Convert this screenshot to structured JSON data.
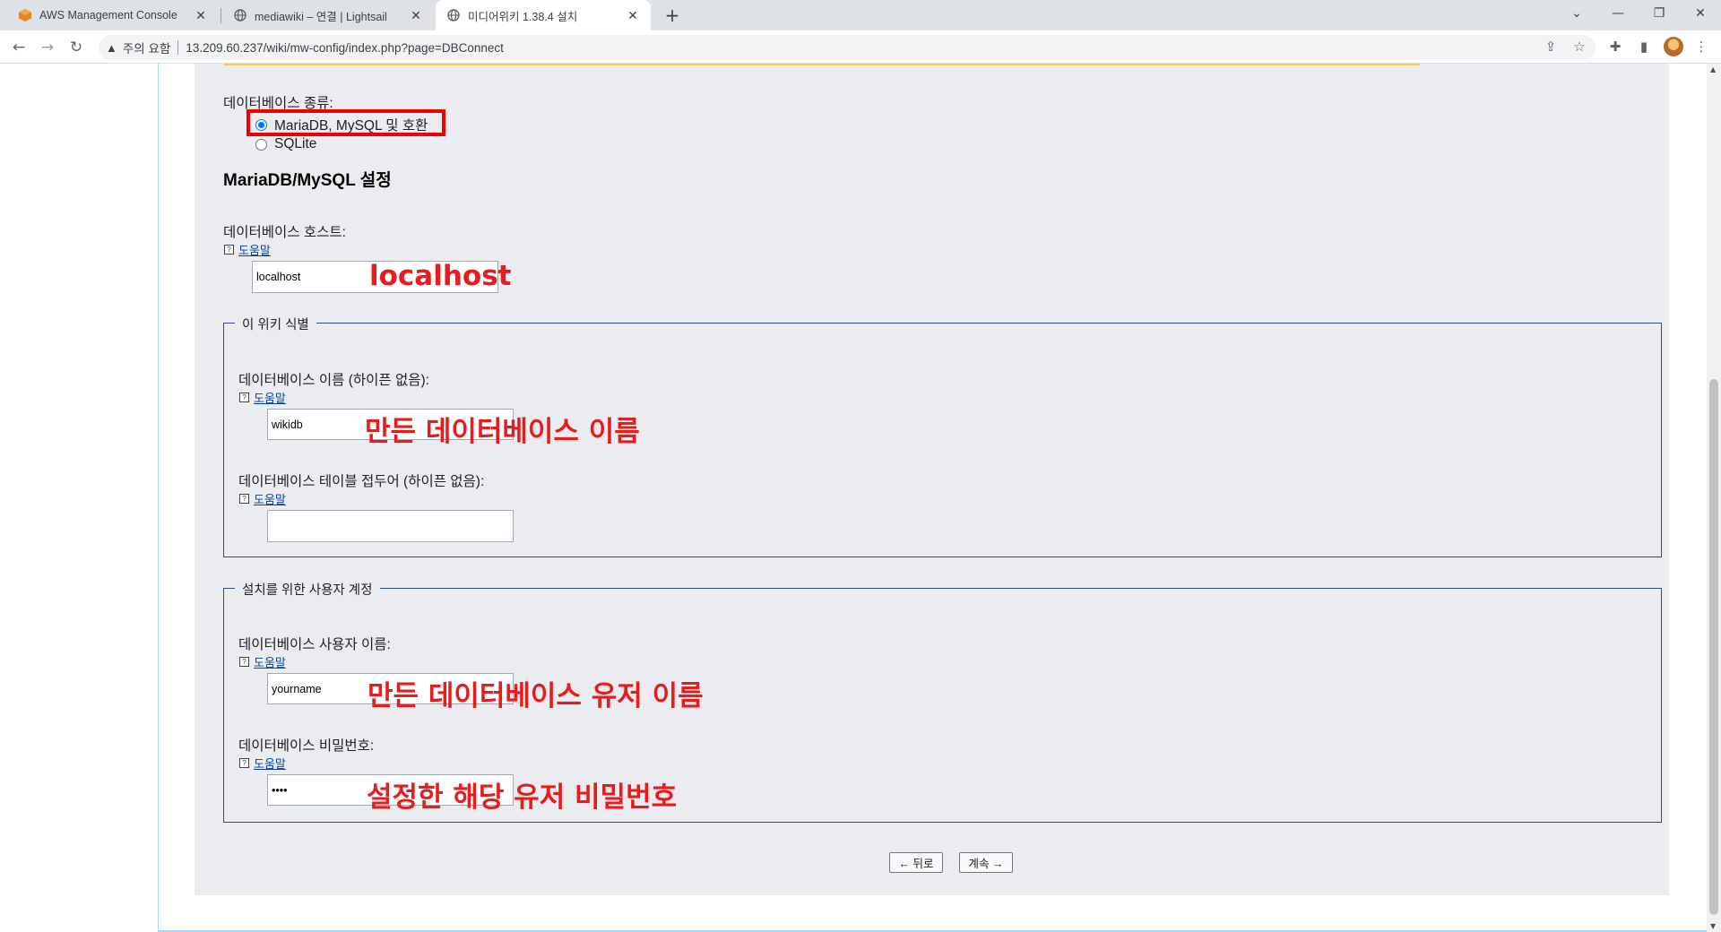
{
  "browser": {
    "tabs": [
      {
        "title": "AWS Management Console",
        "icon": "aws-cube-icon"
      },
      {
        "title": "mediawiki – 연결 | Lightsail",
        "icon": "globe-icon"
      },
      {
        "title": "미디어위키 1.38.4 설치",
        "icon": "globe-icon"
      }
    ],
    "new_tab": "+",
    "security_warning": "주의 요함",
    "url": "13.209.60.237/wiki/mw-config/index.php?page=DBConnect"
  },
  "form": {
    "db_type_label": "데이터베이스 종류:",
    "db_type_options": [
      {
        "label": "MariaDB, MySQL 및 호환",
        "selected": true
      },
      {
        "label": "SQLite",
        "selected": false
      }
    ],
    "section_heading": "MariaDB/MySQL 설정",
    "host_label": "데이터베이스 호스트:",
    "help_text": "도움말",
    "host_value": "localhost",
    "wiki_id_legend": "이 위키 식별",
    "db_name_label": "데이터베이스 이름 (하이픈 없음):",
    "db_name_value": "wikidb",
    "table_prefix_label": "데이터베이스 테이블 접두어 (하이픈 없음):",
    "table_prefix_value": "",
    "install_account_legend": "설치를 위한 사용자 계정",
    "db_user_label": "데이터베이스 사용자 이름:",
    "db_user_value": "yourname",
    "db_password_label": "데이터베이스 비밀번호:",
    "db_password_value": "••••",
    "back_button": "← 뒤로",
    "continue_button": "계속 →"
  },
  "annotations": {
    "host": "localhost",
    "db_name": "만든 데이터베이스 이름",
    "db_user": "만든 데이터베이스 유저 이름",
    "db_password": "설정한 해당 유저 비밀번호"
  },
  "colors": {
    "annotation_red": "#e81c1c",
    "fieldset_border": "#2a4b8d",
    "link_blue": "#0645ad",
    "content_bg": "#eaecf0"
  }
}
